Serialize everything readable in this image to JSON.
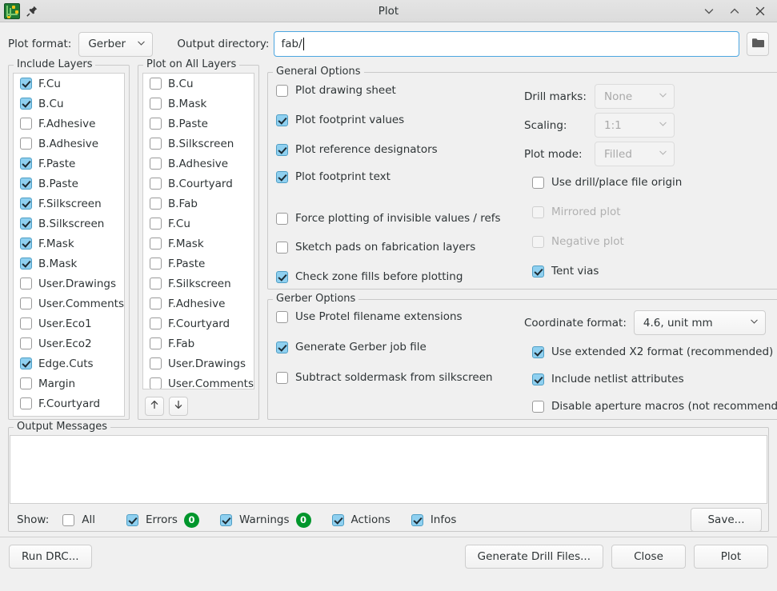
{
  "window": {
    "title": "Plot",
    "app_icon": "kicad-pcb-icon",
    "pin_icon": "pin-icon",
    "controls": [
      {
        "name": "minimize-button",
        "icon": "chevron-down-icon"
      },
      {
        "name": "maximize-button",
        "icon": "chevron-up-icon"
      },
      {
        "name": "close-button",
        "icon": "close-icon"
      }
    ]
  },
  "toolbar": {
    "plot_format_label": "Plot format:",
    "plot_format_value": "Gerber",
    "output_directory_label": "Output directory:",
    "output_directory_value": "fab/",
    "output_directory_placeholder": "",
    "browse_icon": "folder-icon"
  },
  "include_layers": {
    "title": "Include Layers",
    "items": [
      {
        "label": "F.Cu",
        "checked": true
      },
      {
        "label": "B.Cu",
        "checked": true
      },
      {
        "label": "F.Adhesive",
        "checked": false
      },
      {
        "label": "B.Adhesive",
        "checked": false
      },
      {
        "label": "F.Paste",
        "checked": true
      },
      {
        "label": "B.Paste",
        "checked": true
      },
      {
        "label": "F.Silkscreen",
        "checked": true
      },
      {
        "label": "B.Silkscreen",
        "checked": true
      },
      {
        "label": "F.Mask",
        "checked": true
      },
      {
        "label": "B.Mask",
        "checked": true
      },
      {
        "label": "User.Drawings",
        "checked": false
      },
      {
        "label": "User.Comments",
        "checked": false
      },
      {
        "label": "User.Eco1",
        "checked": false
      },
      {
        "label": "User.Eco2",
        "checked": false
      },
      {
        "label": "Edge.Cuts",
        "checked": true
      },
      {
        "label": "Margin",
        "checked": false
      },
      {
        "label": "F.Courtyard",
        "checked": false
      }
    ]
  },
  "plot_on_all_layers": {
    "title": "Plot on All Layers",
    "items": [
      {
        "label": "B.Cu",
        "checked": false
      },
      {
        "label": "B.Mask",
        "checked": false
      },
      {
        "label": "B.Paste",
        "checked": false
      },
      {
        "label": "B.Silkscreen",
        "checked": false
      },
      {
        "label": "B.Adhesive",
        "checked": false
      },
      {
        "label": "B.Courtyard",
        "checked": false
      },
      {
        "label": "B.Fab",
        "checked": false
      },
      {
        "label": "F.Cu",
        "checked": false
      },
      {
        "label": "F.Mask",
        "checked": false
      },
      {
        "label": "F.Paste",
        "checked": false
      },
      {
        "label": "F.Silkscreen",
        "checked": false
      },
      {
        "label": "F.Adhesive",
        "checked": false
      },
      {
        "label": "F.Courtyard",
        "checked": false
      },
      {
        "label": "F.Fab",
        "checked": false
      },
      {
        "label": "User.Drawings",
        "checked": false
      },
      {
        "label": "User.Comments",
        "checked": false
      }
    ],
    "move_up_icon": "arrow-up-icon",
    "move_down_icon": "arrow-down-icon"
  },
  "general_options": {
    "title": "General Options",
    "checkboxes": [
      {
        "label": "Plot drawing sheet",
        "checked": false,
        "disabled": false
      },
      {
        "label": "Plot footprint values",
        "checked": true,
        "disabled": false
      },
      {
        "label": "Plot reference designators",
        "checked": true,
        "disabled": false
      },
      {
        "label": "Plot footprint text",
        "checked": true,
        "disabled": false
      },
      {
        "label": "Force plotting of invisible values / refs",
        "checked": false,
        "disabled": false
      },
      {
        "label": "Sketch pads on fabrication layers",
        "checked": false,
        "disabled": false
      },
      {
        "label": "Check zone fills before plotting",
        "checked": true,
        "disabled": false
      }
    ],
    "fields": [
      {
        "label": "Drill marks:",
        "value": "None",
        "disabled": true
      },
      {
        "label": "Scaling:",
        "value": "1:1",
        "disabled": true
      },
      {
        "label": "Plot mode:",
        "value": "Filled",
        "disabled": true
      }
    ],
    "right_checkboxes": [
      {
        "label": "Use drill/place file origin",
        "checked": false,
        "disabled": false
      },
      {
        "label": "Mirrored plot",
        "checked": false,
        "disabled": true
      },
      {
        "label": "Negative plot",
        "checked": false,
        "disabled": true
      },
      {
        "label": "Tent vias",
        "checked": true,
        "disabled": false
      }
    ]
  },
  "gerber_options": {
    "title": "Gerber Options",
    "checkboxes": [
      {
        "label": "Use Protel filename extensions",
        "checked": false
      },
      {
        "label": "Generate Gerber job file",
        "checked": true
      },
      {
        "label": "Subtract soldermask from silkscreen",
        "checked": false
      }
    ],
    "coordinate_format_label": "Coordinate format:",
    "coordinate_format_value": "4.6, unit mm",
    "right_checkboxes": [
      {
        "label": "Use extended X2 format (recommended)",
        "checked": true
      },
      {
        "label": "Include netlist attributes",
        "checked": true
      },
      {
        "label": "Disable aperture macros (not recommended)",
        "checked": false
      }
    ]
  },
  "output_messages": {
    "title": "Output Messages",
    "body": "",
    "show_label": "Show:",
    "filters": [
      {
        "label": "All",
        "checked": false,
        "badge": null
      },
      {
        "label": "Errors",
        "checked": true,
        "badge": "0"
      },
      {
        "label": "Warnings",
        "checked": true,
        "badge": "0"
      },
      {
        "label": "Actions",
        "checked": true,
        "badge": null
      },
      {
        "label": "Infos",
        "checked": true,
        "badge": null
      }
    ],
    "save_label": "Save..."
  },
  "footer": {
    "run_drc_label": "Run DRC...",
    "generate_drill_label": "Generate Drill Files...",
    "close_label": "Close",
    "plot_label": "Plot"
  },
  "colors": {
    "accent": "#4ca6e0",
    "checkbox_on": "#8fd0f0",
    "badge_green": "#00962c",
    "window_bg": "#f0f0f0"
  }
}
